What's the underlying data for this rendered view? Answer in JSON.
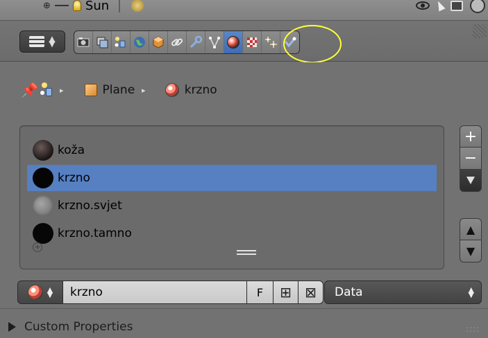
{
  "outliner": {
    "lamp_label": "Sun"
  },
  "header": {
    "tabs": [
      {
        "icon": "render-icon"
      },
      {
        "icon": "render-layers-icon"
      },
      {
        "icon": "scene-icon"
      },
      {
        "icon": "world-icon"
      },
      {
        "icon": "object-icon"
      },
      {
        "icon": "constraints-icon"
      },
      {
        "icon": "modifiers-icon"
      },
      {
        "icon": "object-data-icon"
      },
      {
        "icon": "material-icon",
        "active": true
      },
      {
        "icon": "texture-icon"
      },
      {
        "icon": "particles-icon"
      },
      {
        "icon": "physics-icon"
      }
    ],
    "highlight_color": "#ffff3a",
    "active_tab_color": "#5680c2"
  },
  "breadcrumb": {
    "object": "Plane",
    "material": "krzno"
  },
  "material_slots": {
    "items": [
      {
        "name": "koža",
        "selected": false
      },
      {
        "name": "krzno",
        "selected": true
      },
      {
        "name": "krzno.svjet",
        "selected": false
      },
      {
        "name": "krzno.tamno",
        "selected": false
      }
    ]
  },
  "datablock": {
    "material_name": "krzno",
    "fake_user_label": "F",
    "link_mode": "Data"
  },
  "custom_properties": {
    "label": "Custom Properties"
  }
}
